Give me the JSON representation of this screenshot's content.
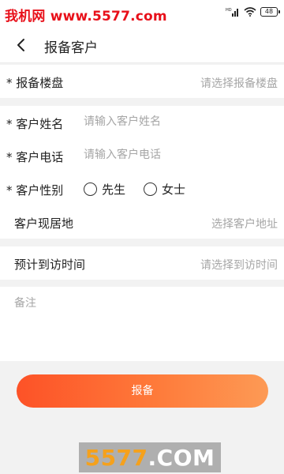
{
  "status_bar": {
    "watermark_text": "我机网 www.5577.com",
    "battery_level": "48",
    "signal_label": "HD"
  },
  "nav": {
    "back_icon": "chevron-left-icon",
    "title": "报备客户"
  },
  "form": {
    "property": {
      "label": "* 报备楼盘",
      "placeholder": "请选择报备楼盘"
    },
    "name": {
      "label": "* 客户姓名",
      "placeholder": "请输入客户姓名"
    },
    "phone": {
      "label": "* 客户电话",
      "placeholder": "请输入客户电话"
    },
    "gender": {
      "label": "* 客户性别",
      "options": [
        {
          "label": "先生",
          "selected": false
        },
        {
          "label": "女士",
          "selected": false
        }
      ]
    },
    "residence": {
      "label": "客户现居地",
      "placeholder": "选择客户地址"
    },
    "visit_time": {
      "label": "预计到访时间",
      "placeholder": "请选择到访时间"
    },
    "remark": {
      "placeholder": "备注"
    }
  },
  "submit": {
    "label": "报备"
  },
  "watermark_bottom": {
    "prefix": "5577",
    "suffix": ".COM"
  },
  "colors": {
    "accent_start": "#fd5227",
    "accent_end": "#fd9a55",
    "watermark_red": "#e8101a",
    "placeholder": "#a6a6a6"
  }
}
